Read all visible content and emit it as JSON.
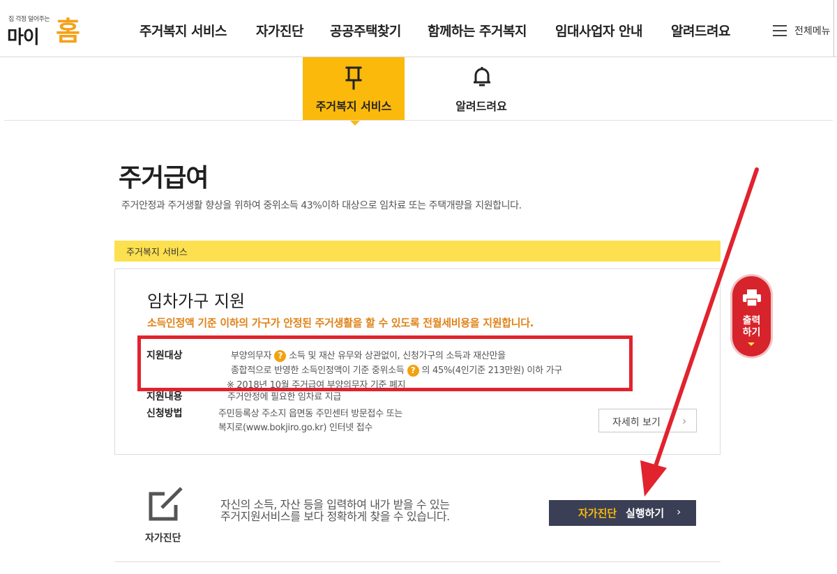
{
  "header": {
    "logo_tagline": "집 걱정 덜어주는",
    "logo_main": "마이",
    "logo_accent": "홈",
    "nav": [
      "주거복지 서비스",
      "자가진단",
      "공공주택찾기",
      "함께하는 주거복지",
      "임대사업자 안내",
      "알려드려요"
    ],
    "menu_label": "전체메뉴"
  },
  "tabs": [
    {
      "label": "주거복지 서비스",
      "icon": "pin-icon",
      "active": true
    },
    {
      "label": "알려드려요",
      "icon": "bell-icon",
      "active": false
    }
  ],
  "page": {
    "title": "주거급여",
    "description": "주거안정과 주거생활 향상을 위하여 중위소득 43%이하 대상으로 임차료 또는 주택개량을 지원합니다."
  },
  "service_band": {
    "label": "주거복지 서비스"
  },
  "card": {
    "title": "임차가구 지원",
    "highlight": "소득인정액 기준 이하의 가구가 안정된 주거생활을 할 수 있도록 전월세비용을 지원합니다.",
    "target": {
      "label": "지원대상",
      "line1_a": "부양의무자",
      "line1_b": "소득 및 재산 유무와 상관없이, 신청가구의 소득과 재산만을",
      "line2_a": "종합적으로 반영한 소득인정액이 기준 중위소득",
      "line2_b": "의 45%(4인기준 213만원) 이하 가구",
      "line3": "※ 2018년 10월 주거급여 부양의무자 기준 폐지",
      "help_glyph": "?"
    },
    "content": {
      "label": "지원내용",
      "text": "주거안정에 필요한 임차료 지급"
    },
    "apply": {
      "label": "신청방법",
      "line1": "주민등록상 주소지 읍면동 주민센터 방문접수 또는",
      "line2": "복지로(www.bokjiro.go.kr) 인터넷 접수"
    },
    "detail_button": "자세히 보기"
  },
  "print_button": {
    "line1": "출력",
    "line2": "하기"
  },
  "self_diagnosis": {
    "icon_label": "자가진단",
    "text_line1": "자신의 소득, 자산 등을 입력하여 내가 받을 수 있는",
    "text_line2": "주거지원서비스를 보다 정확하게 찾을 수 있습니다.",
    "button_highlight": "자가진단",
    "button_text": "실행하기"
  },
  "colors": {
    "accent_yellow": "#fbb90b",
    "band_yellow": "#fde04f",
    "annotation_red": "#e1232e",
    "orange_text": "#e08217",
    "dark_button": "#3a3f55",
    "print_red": "#d7232b"
  }
}
